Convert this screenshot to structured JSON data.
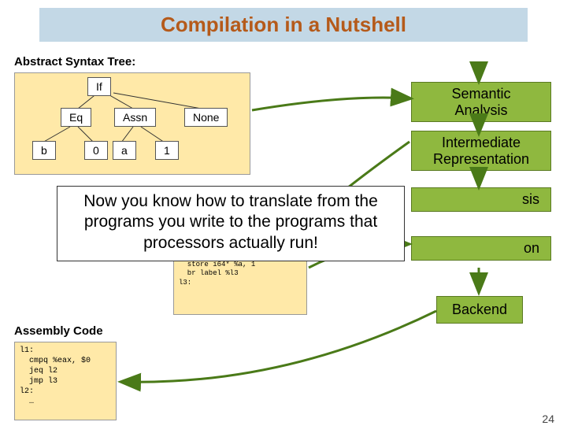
{
  "title": "Compilation in a Nutshell",
  "ast": {
    "label": "Abstract Syntax Tree:",
    "nodes": {
      "if": "If",
      "eq": "Eq",
      "assn": "Assn",
      "none": "None",
      "b": "b",
      "zero": "0",
      "a": "a",
      "one": "1"
    }
  },
  "callout": {
    "line1": "Now you know how to translate from the",
    "line2": "programs you write to the programs that",
    "line3": "processors actually run!"
  },
  "ir_code": "  store i64* %a, 1\n  br label %l3\nl3:",
  "asm": {
    "label": "Assembly Code",
    "code": "l1:\n  cmpq %eax, $0\n  jeq l2\n  jmp l3\nl2:\n  …"
  },
  "stages": {
    "semantic": "Semantic\nAnalysis",
    "ir": "Intermediate\nRepresentation",
    "analysis_tail": "sis",
    "codegen_tail": "on",
    "backend": "Backend"
  },
  "slidenum": "24"
}
